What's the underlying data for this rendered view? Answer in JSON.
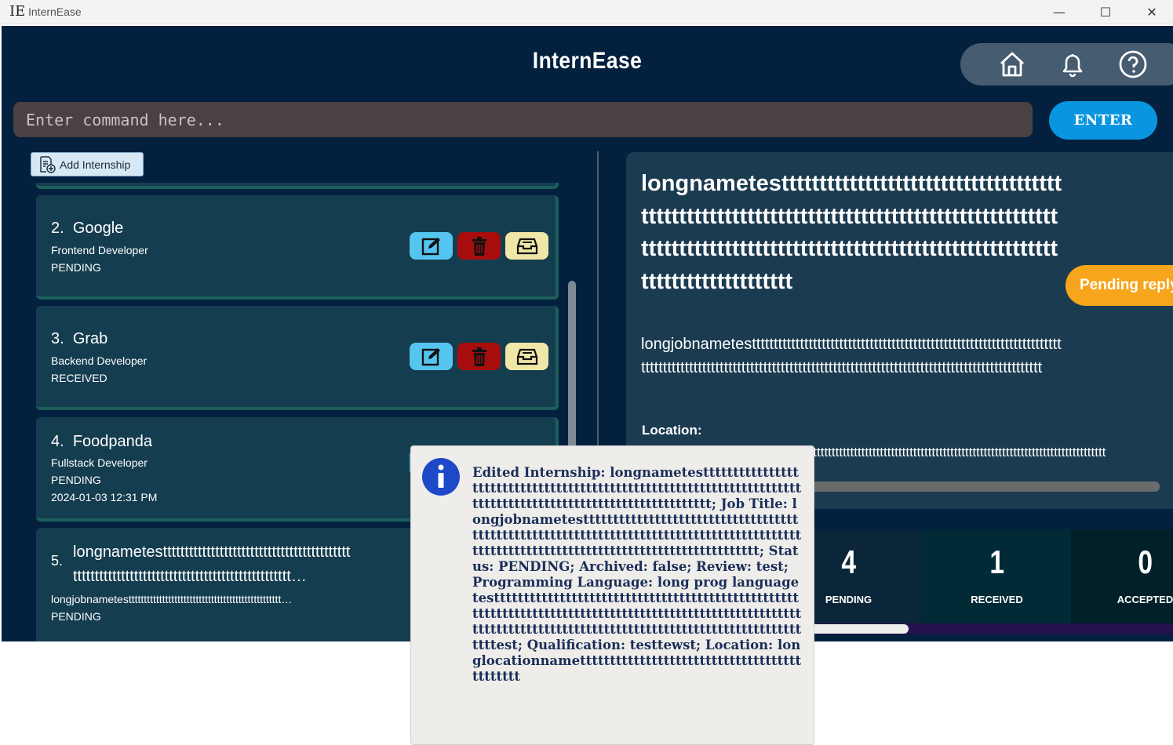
{
  "window": {
    "logo": "IE",
    "title": "InternEase",
    "minimize": "—",
    "maximize": "☐",
    "close": "✕"
  },
  "header": {
    "app_title": "InternEase",
    "nav_icons": [
      "home-icon",
      "bell-icon",
      "help-icon"
    ]
  },
  "command": {
    "placeholder": "Enter command here...",
    "enter_label": "ENTER"
  },
  "toolbar": {
    "add_label": "Add Internship"
  },
  "internships": [
    {
      "index": "2.",
      "company": "Google",
      "role": "Frontend Developer",
      "status": "PENDING"
    },
    {
      "index": "3.",
      "company": "Grab",
      "role": "Backend Developer",
      "status": "RECEIVED"
    },
    {
      "index": "4.",
      "company": "Foodpanda",
      "role": "Fullstack Developer",
      "status": "PENDING",
      "date": "2024-01-03 12:31 PM"
    },
    {
      "index": "5.",
      "company_line1": "longnametesttttttttttttttttttttttttttttttttttttttttttt",
      "company_line2": "tttttttttttttttttttttttttttttttttttttttttttttttttt…",
      "role": "longjobnametestttttttttttttttttttttttttttttttttttttttttttttttttt…",
      "status": "PENDING"
    }
  ],
  "detail": {
    "name": "longnametesttttttttttttttttttttttttttttttttttttttttttttttttttttttttttttttttttttttttttttttttttttttttttttttttttttttttttttttttttttttttttttttttttttttttttttttttttttttttttttttttttttttt",
    "position": "longjobnametesttttttttttttttttttttttttttttttttttttttttttttttttttttttttttttttttttttttttttttttttttttttttttttttttttttttttttttttttttttttttttttttttttttttttttttttttttttttttttttttttttt",
    "location_label": "Location:",
    "location_value": "longlocationnamettttttttttttttttttttttttttttttttttttttttttttttttttttttttttttttttttttttttttttttttttttttttttttttttt",
    "status_badge": "Pending reply"
  },
  "stats": [
    {
      "value": "4",
      "label": "PENDING"
    },
    {
      "value": "1",
      "label": "RECEIVED"
    },
    {
      "value": "0",
      "label": "ACCEPTED"
    }
  ],
  "popup": {
    "message": "Edited Internship: longnametesttttttttttttttttttttttttttttttttttttttttttttttttttttttttttttttttttttttttttttttttttttttttttttttttttttttttttttttt; Job Title: longjobnametesttttttttttttttttttttttttttttttttttttttttttttttttttttttttttttttttttttttttttttttttttttttttttttttttttttttttttttttttttttttttttttttttttttttttttt; Status: PENDING; Archived: false; Review: test; Programming Language: long prog language testttttttttttttttttttttttttttttttttttttttttttttttttttttttttttttttttttttttttttttttttttttttttttttttttttttttttttttttttttttttttttttttttttttttttttttttttttttttttttttttttttttest; Qualification: testtewst; Location: longlocationnamettttttttttttttttttttttttttttttttttttttttttttt"
  },
  "colors": {
    "app_bg": "#03213f",
    "card_bg": "#153d50",
    "enter_btn": "#0a95e0",
    "pending_badge": "#f7a51c",
    "edit_btn": "#55c5f0",
    "delete_btn": "#a80d0d",
    "archive_btn": "#efe6a8"
  }
}
